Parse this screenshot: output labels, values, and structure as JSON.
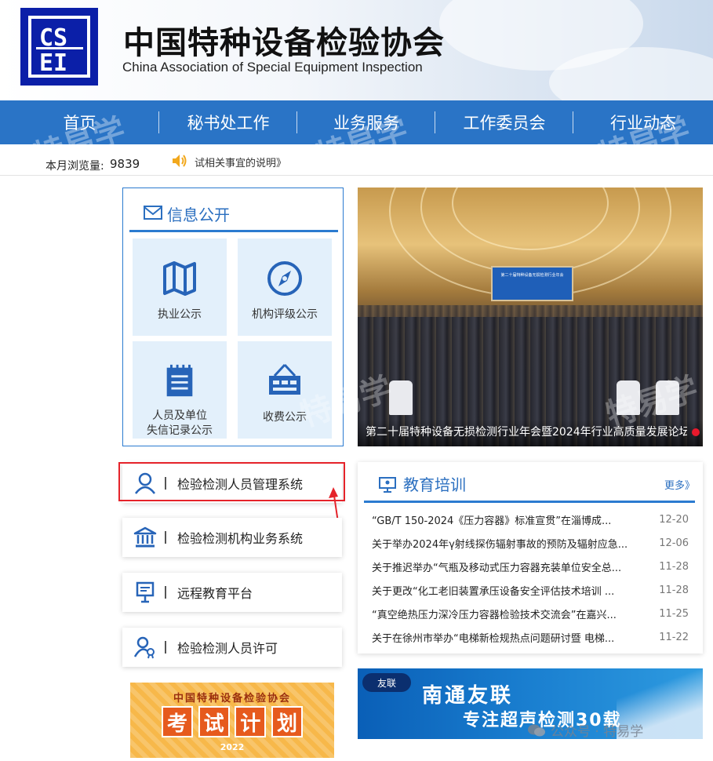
{
  "header": {
    "title": "中国特种设备检验协会",
    "subtitle": "China Association of Special Equipment Inspection",
    "logo_icon": "csei-logo-icon"
  },
  "nav": {
    "items": [
      {
        "label": "首页"
      },
      {
        "label": "秘书处工作"
      },
      {
        "label": "业务服务"
      },
      {
        "label": "工作委员会"
      },
      {
        "label": "行业动态"
      }
    ]
  },
  "infobar": {
    "visits_label": "本月浏览量:",
    "visits_count": "9839",
    "notice": "试相关事宜的说明》"
  },
  "info_panel": {
    "title": "信息公开",
    "tiles": [
      {
        "label": "执业公示",
        "icon": "map-icon"
      },
      {
        "label": "机构评级公示",
        "icon": "compass-icon"
      },
      {
        "label_line1": "人员及单位",
        "label_line2": "失信记录公示",
        "icon": "notepad-icon"
      },
      {
        "label": "收费公示",
        "icon": "cash-register-icon"
      }
    ]
  },
  "photo": {
    "caption": "第二十届特种设备无损检测行业年会暨2024年行业高质量发展论坛",
    "screen_text": "第二十届特种设备无损检测行业年会"
  },
  "systems": [
    {
      "label": "检验检测人员管理系统",
      "icon": "person-icon"
    },
    {
      "label": "检验检测机构业务系统",
      "icon": "bank-icon"
    },
    {
      "label": "远程教育平台",
      "icon": "presentation-icon"
    },
    {
      "label": "检验检测人员许可",
      "icon": "person-badge-icon"
    }
  ],
  "exam_banner": {
    "org": "中国特种设备检验协会",
    "chars": [
      "考",
      "试",
      "计",
      "划"
    ],
    "year": "2022"
  },
  "education": {
    "title": "教育培训",
    "more": "更多》",
    "news": [
      {
        "title": "“GB/T 150-2024《压力容器》标准宣贯”在淄博成...",
        "date": "12-20"
      },
      {
        "title": "关于举办2024年γ射线探伤辐射事故的预防及辐射应急...",
        "date": "12-06"
      },
      {
        "title": "关于推迟举办“气瓶及移动式压力容器充装单位安全总...",
        "date": "11-28"
      },
      {
        "title": "关于更改“化工老旧装置承压设备安全评估技术培训 ...",
        "date": "11-28"
      },
      {
        "title": "“真空绝热压力深冷压力容器检验技术交流会”在嘉兴...",
        "date": "11-25"
      },
      {
        "title": "关于在徐州市举办“电梯新检规热点问题研讨暨 电梯...",
        "date": "11-22"
      }
    ]
  },
  "ad_banner": {
    "brand": "友联",
    "title": "南通友联",
    "slogan": "专注超声检测30载"
  },
  "watermark": {
    "text": "特易学",
    "wechat_label": "公众号 · 特易学"
  },
  "colors": {
    "nav_blue": "#2a74c6",
    "accent_blue": "#2b7bd0",
    "highlight_red": "#e5232a",
    "logo_blue": "#0b1fa8"
  }
}
